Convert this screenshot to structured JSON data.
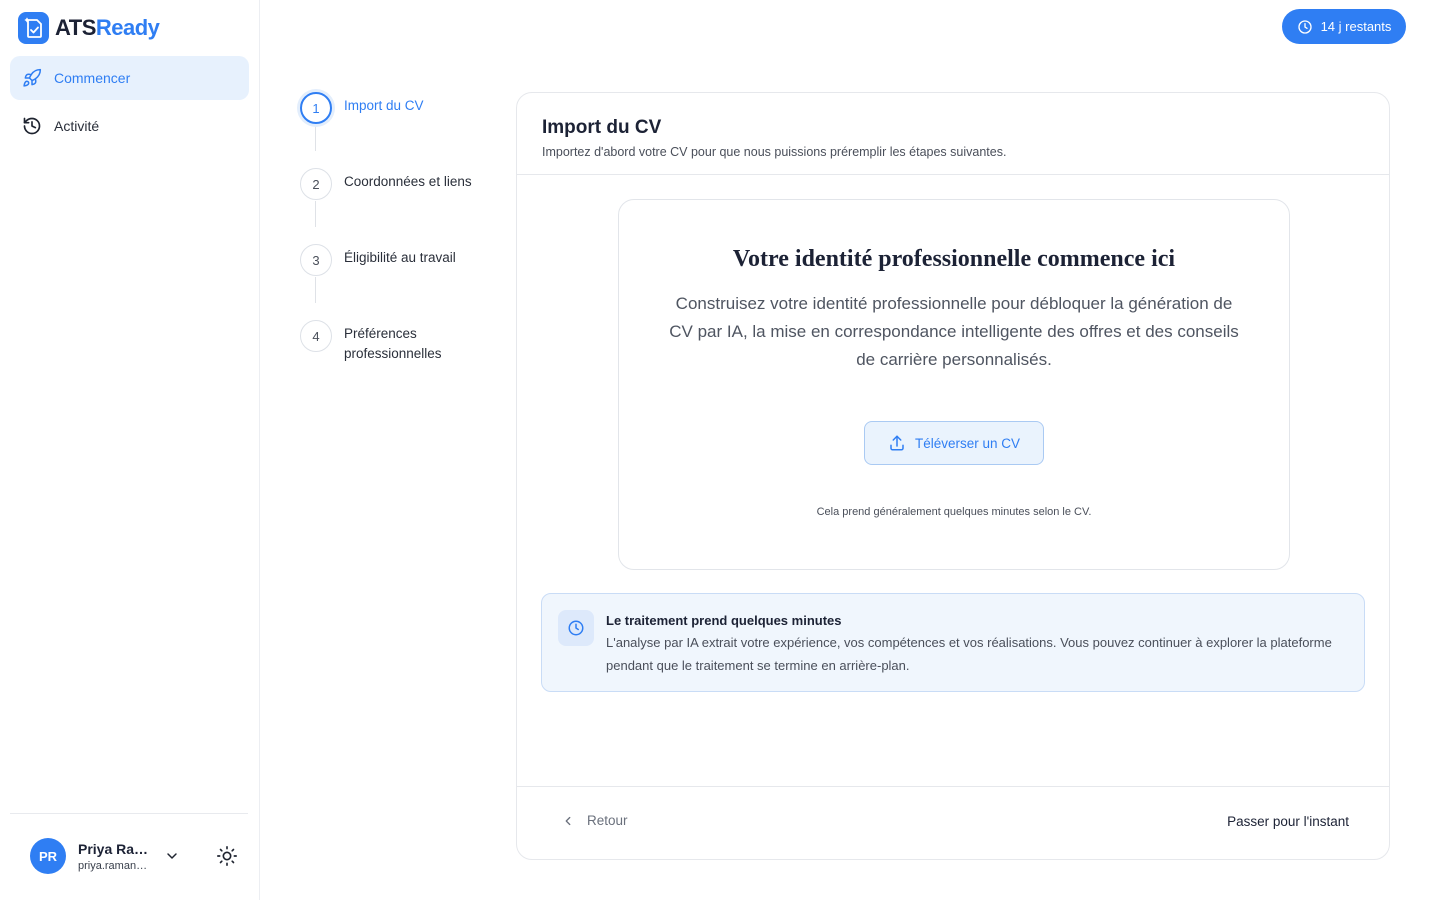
{
  "brand": {
    "name_part1": "ATS",
    "name_part2": "Ready"
  },
  "sidebar": {
    "items": [
      {
        "label": "Commencer",
        "icon": "rocket-icon",
        "active": true
      },
      {
        "label": "Activité",
        "icon": "history-icon",
        "active": false
      }
    ]
  },
  "user": {
    "initials": "PR",
    "name": "Priya Ram...",
    "email": "priya.raman@..."
  },
  "trial_badge": {
    "label": "14 j restants",
    "icon": "clock-icon"
  },
  "steps": [
    {
      "number": "1",
      "label": "Import du CV",
      "active": true
    },
    {
      "number": "2",
      "label": "Coordonnées et liens",
      "active": false
    },
    {
      "number": "3",
      "label": "Éligibilité au travail",
      "active": false
    },
    {
      "number": "4",
      "label": "Préférences professionnelles",
      "active": false
    }
  ],
  "card": {
    "title": "Import du CV",
    "subtitle": "Importez d'abord votre CV pour que nous puissions préremplir les étapes suivantes."
  },
  "upload": {
    "heading": "Votre identité professionnelle commence ici",
    "description": "Construisez votre identité professionnelle pour débloquer la génération de CV par IA, la mise en correspondance intelligente des offres et des conseils de carrière personnalisés.",
    "button_label": "Téléverser un CV",
    "note": "Cela prend généralement quelques minutes selon le CV."
  },
  "info": {
    "title": "Le traitement prend quelques minutes",
    "text": "L'analyse par IA extrait votre expérience, vos compétences et vos réalisations. Vous pouvez continuer à explorer la plateforme pendant que le traitement se termine en arrière-plan."
  },
  "footer": {
    "back_label": "Retour",
    "skip_label": "Passer pour l'instant"
  },
  "colors": {
    "accent": "#2f7ef3",
    "accent_light": "#e7f1fd",
    "info_bg": "#f0f6fd"
  }
}
